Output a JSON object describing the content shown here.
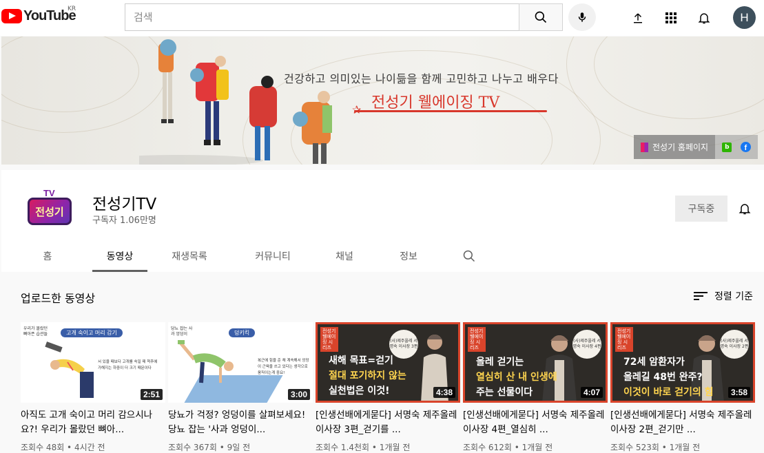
{
  "masthead": {
    "logo_text": "YouTube",
    "country": "KR",
    "search_placeholder": "검색",
    "avatar_letter": "H",
    "icons": [
      "search-icon",
      "mic-icon",
      "upload-icon",
      "apps-icon",
      "bell-icon"
    ]
  },
  "banner": {
    "subtitle": "건강하고 의미있는 나이듦을 함께 고민하고 나누고 배우다",
    "title": "전성기 웰에이징 TV",
    "homepage_link": "전성기 홈페이지"
  },
  "channel": {
    "name": "전성기TV",
    "subscribers": "구독자 1.06만명",
    "subscribe_label": "구독중",
    "logo_tv": "TV",
    "logo_text": "전성기"
  },
  "tabs": [
    {
      "label": "홈"
    },
    {
      "label": "동영상",
      "active": true
    },
    {
      "label": "재생목록"
    },
    {
      "label": "커뮤니티"
    },
    {
      "label": "채널"
    },
    {
      "label": "정보"
    }
  ],
  "section": {
    "title": "업로드한 동영상",
    "sort_label": "정렬 기준"
  },
  "videos": [
    {
      "title": "아직도 고개 숙이고 머리 감으시나요?! 우리가 몰랐던 뼈아...",
      "meta": "조회수 48회 • 4시간 전",
      "duration": "2:51",
      "thumb": {
        "badge": "우리가 몰랐던 뼈아픈 습관들",
        "pill": "고개 숙이고 머리 감기",
        "text": "서 있을 때보다 고개를 숙일 때 척추에 가해지는 하중이 더 크기 때문이다"
      }
    },
    {
      "title": "당뇨가 걱정? 엉덩이를 살펴보세요! 당뇨 잡는 '사과 엉덩이...",
      "meta": "조회수 367회 • 9일 전",
      "duration": "3:00",
      "thumb": {
        "badge": "당뇨 잡는 사과 엉덩이",
        "pill": "덩키킥",
        "text": "복근에 힘을 준 채 계속해서 엉덩이 근육을 쓰고 있다는 생각으로 움직이는게 중요!"
      }
    },
    {
      "title": "[인생선배에게묻다] 서명숙 제주올레 이사장 3편_걷기를 ...",
      "meta": "조회수 1.4천회 • 1개월 전",
      "duration": "4:38",
      "thumb": {
        "badge": "전성기 웰에이징 시리즈",
        "circle": "(사)제주올레 서명숙 이사장 3편",
        "line1": "새해 목표=걷기",
        "line2": "절대 포기하지 않는",
        "line3": "실천법은 이것!"
      }
    },
    {
      "title": "[인생선배에게묻다] 서명숙 제주올레 이사장 4편_열심히 ...",
      "meta": "조회수 612회 • 1개월 전",
      "duration": "4:07",
      "thumb": {
        "badge": "전성기 웰에이징 시리즈",
        "circle": "(사)제주올레 서명숙 이사장 4편",
        "line1": "올레 걷기는",
        "line2": "열심히 산 내 인생에",
        "line3": "주는 선물이다"
      }
    },
    {
      "title": "[인생선배에게묻다] 서명숙 제주올레 이사장 2편_걷기만 ...",
      "meta": "조회수 523회 • 1개월 전",
      "duration": "3:58",
      "thumb": {
        "badge": "전성기 웰에이징 시리즈",
        "circle": "(사)제주올레 서명숙 이사장 2편",
        "line1": "72세 암환자가",
        "line2": "올레길 48번 완주?",
        "line3": "이것이 바로 걷기의 힘"
      }
    }
  ]
}
